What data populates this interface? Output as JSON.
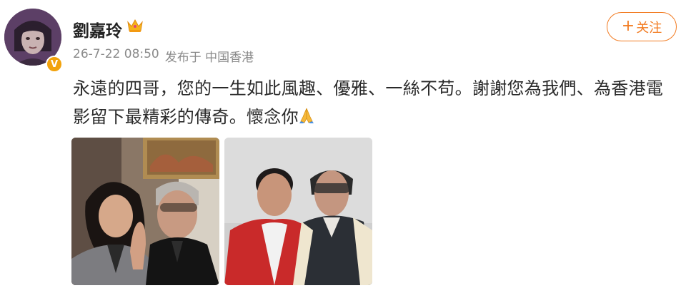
{
  "post": {
    "username": "劉嘉玲",
    "verified_badge": "V",
    "time": "26-7-22 08:50",
    "source": "发布于 中国香港",
    "follow_label": "关注",
    "follow_plus": "+",
    "text": "永遠的四哥，您的一生如此風趣、優雅、一絲不苟。謝謝您為我們、為香港電影留下最精彩的傳奇。懷念你"
  },
  "icons": {
    "crown": "crown-icon",
    "pray": "folded-hands-emoji",
    "verified": "verified-v-badge"
  },
  "colors": {
    "accent": "#f27b21",
    "verified": "#f2a20b",
    "meta_text": "#8a8a8a"
  }
}
